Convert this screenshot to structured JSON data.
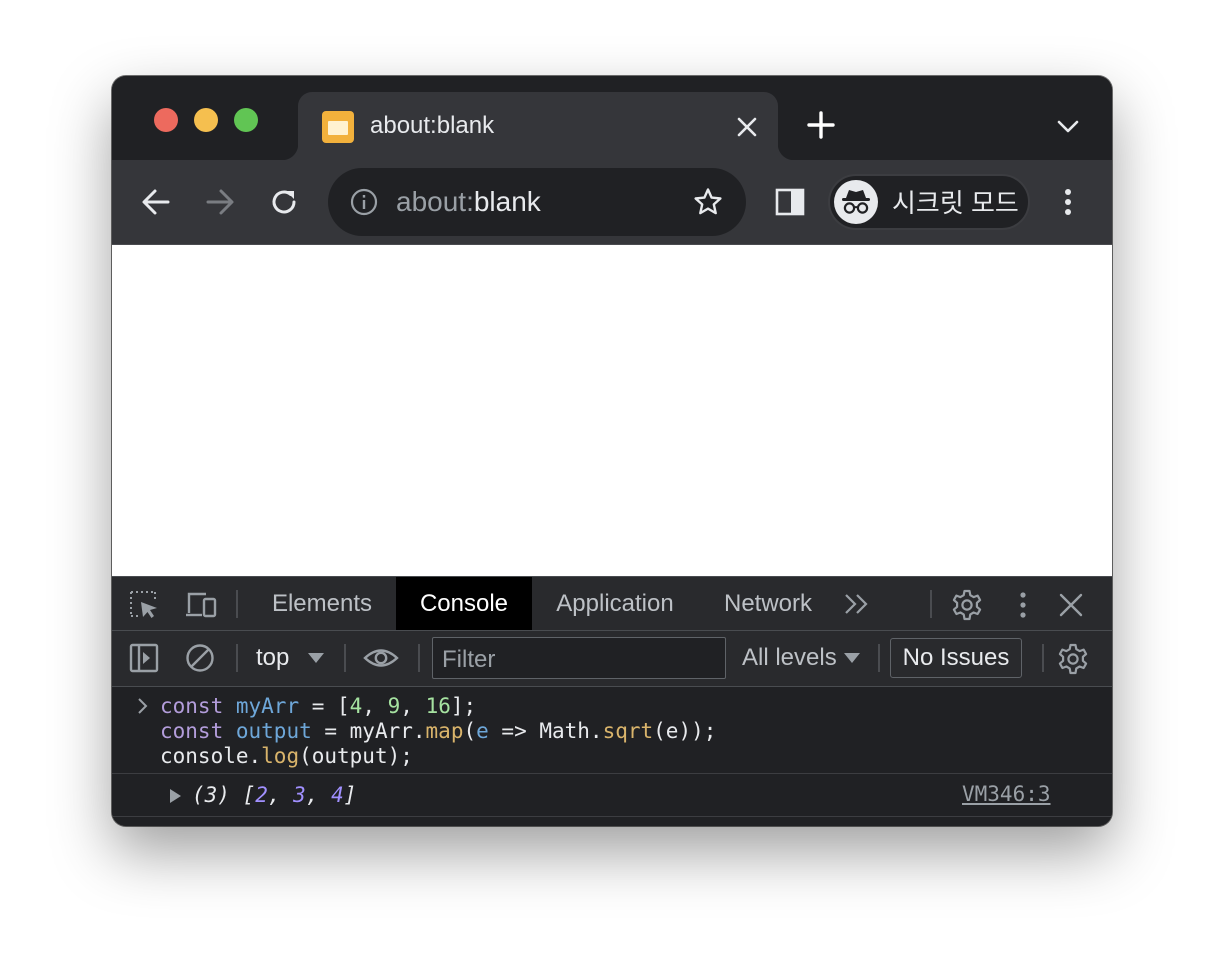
{
  "tab": {
    "title": "about:blank",
    "favicon": "page-favicon"
  },
  "toolbar": {
    "url_scheme": "about:",
    "url_path": "blank",
    "profile_label": "시크릿 모드"
  },
  "devtools": {
    "tabs": [
      "Elements",
      "Console",
      "Application",
      "Network"
    ],
    "active_tab": "Console",
    "context": "top",
    "filter_placeholder": "Filter",
    "levels": "All levels",
    "issues": "No Issues"
  },
  "console": {
    "input_lines": [
      "const myArr = [4, 9, 16];",
      "const output = myArr.map(e => Math.sqrt(e));",
      "console.log(output);"
    ],
    "result": {
      "count": "(3)",
      "values": [
        "2",
        "3",
        "4"
      ],
      "source": "VM346:3"
    }
  },
  "colors": {
    "chrome_dark": "#202124",
    "toolbar": "#35363a",
    "devtools_bg": "#292a2d",
    "active_tab_bg": "#000000",
    "traffic_close": "#ed6a5e",
    "traffic_min": "#f5bf4f",
    "traffic_max": "#61c554",
    "favicon": "#f2b13c"
  }
}
